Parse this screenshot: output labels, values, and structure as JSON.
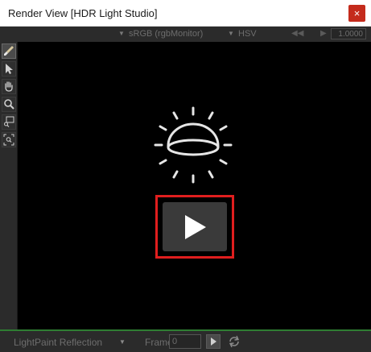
{
  "window": {
    "title": "Render View [HDR Light Studio]",
    "close_glyph": "×"
  },
  "toolbar": {
    "color_space": "sRGB (rgbMonitor)",
    "color_mode": "HSV",
    "exposure_value": "1.0000"
  },
  "tools": [
    {
      "name": "paint-brush-icon",
      "active": true
    },
    {
      "name": "select-arrow-icon",
      "active": false
    },
    {
      "name": "pan-hand-icon",
      "active": false
    },
    {
      "name": "zoom-icon",
      "active": false
    },
    {
      "name": "zoom-region-icon",
      "active": false
    },
    {
      "name": "zoom-fit-icon",
      "active": false
    }
  ],
  "viewport": {
    "logo_icon": "hdr-light-dome-icon",
    "play_icon": "play-icon"
  },
  "status": {
    "layer_label": "LightPaint Reflection",
    "frame_label": "Frame",
    "frame_value": "0"
  },
  "colors": {
    "highlight": "#e01e1e",
    "accent_line": "#2e7d32",
    "panel_bg": "#2b2b2b",
    "viewport_bg": "#000000"
  }
}
